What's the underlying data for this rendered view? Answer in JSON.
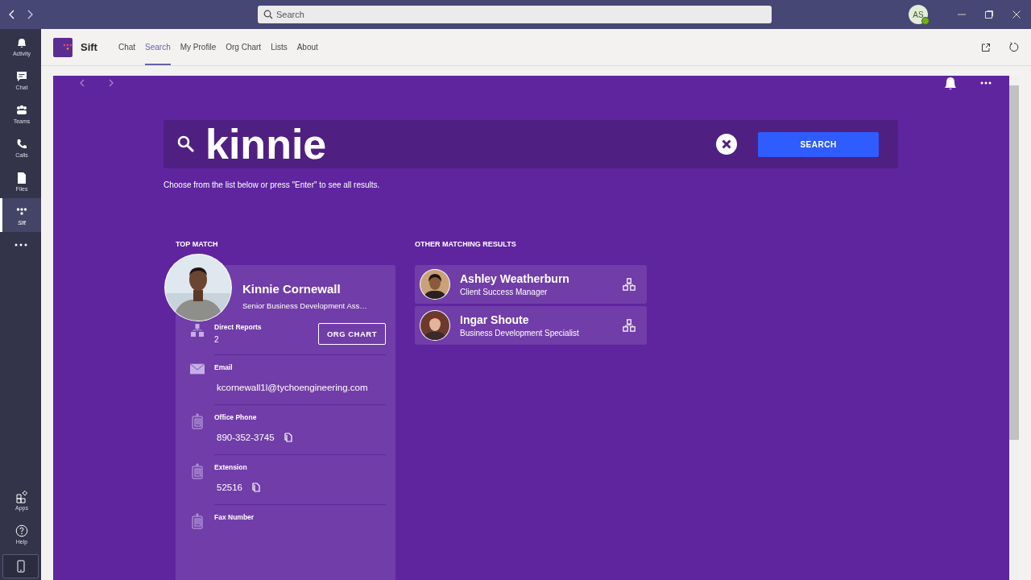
{
  "titlebar": {
    "search_placeholder": "Search",
    "avatar_initials": "AS"
  },
  "rail": {
    "items": [
      {
        "label": "Activity",
        "kind": "bell",
        "selected": false
      },
      {
        "label": "Chat",
        "kind": "chat",
        "selected": false
      },
      {
        "label": "Teams",
        "kind": "teams",
        "selected": false
      },
      {
        "label": "Calls",
        "kind": "phone",
        "selected": false
      },
      {
        "label": "Files",
        "kind": "file",
        "selected": false
      },
      {
        "label": "Sift",
        "kind": "dots",
        "selected": true
      }
    ],
    "bottom_items": [
      {
        "label": "Apps",
        "kind": "apps"
      },
      {
        "label": "Help",
        "kind": "help"
      }
    ]
  },
  "app": {
    "name": "Sift",
    "tabs": [
      {
        "label": "Chat",
        "selected": false
      },
      {
        "label": "Search",
        "selected": true
      },
      {
        "label": "My Profile",
        "selected": false
      },
      {
        "label": "Org Chart",
        "selected": false
      },
      {
        "label": "Lists",
        "selected": false
      },
      {
        "label": "About",
        "selected": false
      }
    ]
  },
  "search": {
    "value": "kinnie",
    "button": "SEARCH",
    "hint": "Choose from the list below or press \"Enter\" to see all results."
  },
  "top_match": {
    "heading": "TOP MATCH",
    "name": "Kinnie Cornewall",
    "title": "Senior Business Development Ass…",
    "org_button": "ORG CHART",
    "fields": [
      {
        "kind": "reports",
        "label": "Direct Reports",
        "value": "2"
      },
      {
        "kind": "email",
        "label": "Email",
        "value": "kcornewall1l@tychoengineering.com"
      },
      {
        "kind": "phone",
        "label": "Office Phone",
        "value": "890-352-3745"
      },
      {
        "kind": "phone",
        "label": "Extension",
        "value": "52516"
      },
      {
        "kind": "phone",
        "label": "Fax Number"
      }
    ]
  },
  "other_results": {
    "heading": "OTHER MATCHING RESULTS",
    "items": [
      {
        "name": "Ashley Weatherburn",
        "title": "Client Success Manager"
      },
      {
        "name": "Ingar Shoute",
        "title": "Business Development Specialist"
      }
    ]
  }
}
